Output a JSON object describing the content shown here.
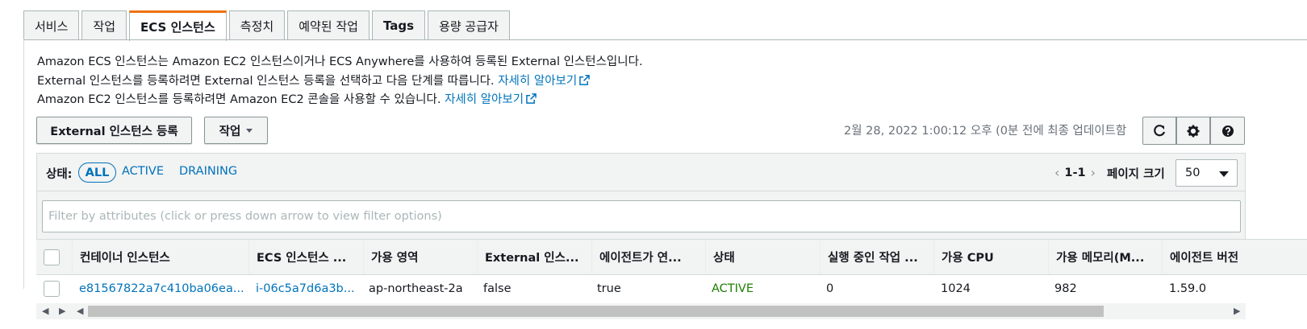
{
  "tabs": [
    {
      "label": "서비스",
      "active": false
    },
    {
      "label": "작업",
      "active": false
    },
    {
      "label": "ECS 인스턴스",
      "active": true
    },
    {
      "label": "측정치",
      "active": false
    },
    {
      "label": "예약된 작업",
      "active": false
    },
    {
      "label": "Tags",
      "active": false
    },
    {
      "label": "용량 공급자",
      "active": false
    }
  ],
  "description": {
    "line1": "Amazon ECS 인스턴스는 Amazon EC2 인스턴스이거나 ECS Anywhere를 사용하여 등록된 External 인스턴스입니다.",
    "line2": "External 인스턴스를 등록하려면 External 인스턴스 등록을 선택하고 다음 단계를 따릅니다.",
    "line2_link": "자세히 알아보기",
    "line3": "Amazon EC2 인스턴스를 등록하려면 Amazon EC2 콘솔을 사용할 수 있습니다.",
    "line3_link": "자세히 알아보기"
  },
  "toolbar": {
    "register_label": "External 인스턴스 등록",
    "actions_label": "작업",
    "last_updated": "2월 28, 2022 1:00:12 오후 (0분 전에 최종 업데이트함",
    "refresh_icon": "refresh-icon",
    "settings_icon": "gear-icon",
    "help_icon": "help-icon"
  },
  "filter": {
    "status_label": "상태:",
    "options": [
      "ALL",
      "ACTIVE",
      "DRAINING"
    ],
    "selected": "ALL",
    "placeholder": "Filter by attributes (click or press down arrow to view filter options)"
  },
  "pagination": {
    "range": "1-1",
    "page_size_label": "페이지 크기",
    "page_size": "50"
  },
  "table": {
    "columns": [
      "컨테이너 인스턴스",
      "ECS 인스턴스 ...",
      "가용 영역",
      "External 인스...",
      "에이전트가 연...",
      "상태",
      "실행 중인 작업 ...",
      "가용 CPU",
      "가용 메모리(M...",
      "에이전트 버전"
    ],
    "rows": [
      [
        "e81567822a7c410ba06ea...",
        "i-06c5a7d6a3b...",
        "ap-northeast-2a",
        "false",
        "true",
        "ACTIVE",
        "0",
        "1024",
        "982",
        "1.59.0"
      ]
    ]
  },
  "colors": {
    "link": "#0073bb",
    "active_tab_accent": "#ec7211",
    "status_active": "#1d8102"
  }
}
